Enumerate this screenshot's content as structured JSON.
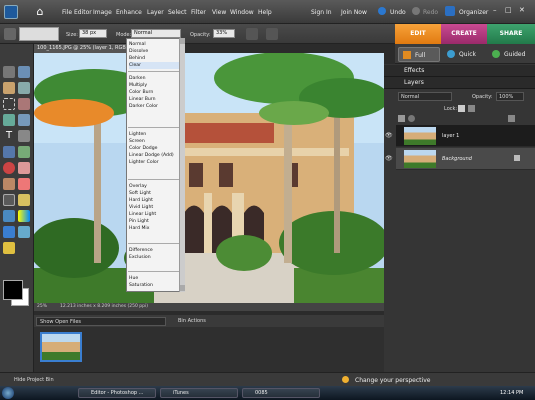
{
  "menubar": {
    "items": [
      "File",
      "Editor",
      "Image",
      "Enhance",
      "Layer",
      "Select",
      "Filter",
      "View",
      "Window",
      "Help"
    ],
    "sign_in": "Sign In",
    "join_now": "Join Now",
    "undo": "Undo",
    "redo": "Redo",
    "organizer": "Organizer"
  },
  "options": {
    "size_label": "Size:",
    "size_value": "38 px",
    "mode_label": "Mode:",
    "mode_value": "Normal",
    "opacity_label": "Opacity:",
    "opacity_value": "33%"
  },
  "tabs": {
    "edit": "EDIT",
    "create": "CREATE",
    "share": "SHARE"
  },
  "edit_modes": {
    "full": "Full",
    "quick": "Quick",
    "guided": "Guided"
  },
  "document": {
    "tab_title": "100_1165.JPG @ 25% (layer 1, RGB",
    "zoom": "25%",
    "dimensions": "12.213 inches x 8.209 inches (250 ppi)"
  },
  "blend_modes": [
    [
      "Normal",
      "Dissolve",
      "Behind",
      "Clear"
    ],
    [
      "Darken",
      "Multiply",
      "Color Burn",
      "Linear Burn",
      "Darker Color"
    ],
    [
      "Lighten",
      "Screen",
      "Color Dodge",
      "Linear Dodge (Add)",
      "Lighter Color"
    ],
    [
      "Overlay",
      "Soft Light",
      "Hard Light",
      "Vivid Light",
      "Linear Light",
      "Pin Light",
      "Hard Mix"
    ],
    [
      "Difference",
      "Exclusion"
    ],
    [
      "Hue",
      "Saturation"
    ]
  ],
  "project_bin": {
    "show_label": "Show Open Files",
    "actions": "Bin Actions",
    "hide": "Hide Project Bin"
  },
  "panels": {
    "effects": "Effects",
    "layers": "Layers",
    "blend": "Normal",
    "opacity_label": "Opacity:",
    "opacity_value": "100%",
    "lock_label": "Lock:",
    "layers_list": [
      "layer 1",
      "Background"
    ]
  },
  "status": {
    "message": "Change your perspective"
  },
  "taskbar": {
    "tasks": [
      "Editor - Photoshop ...",
      "iTunes",
      "0085"
    ],
    "time": "12:14 PM"
  }
}
